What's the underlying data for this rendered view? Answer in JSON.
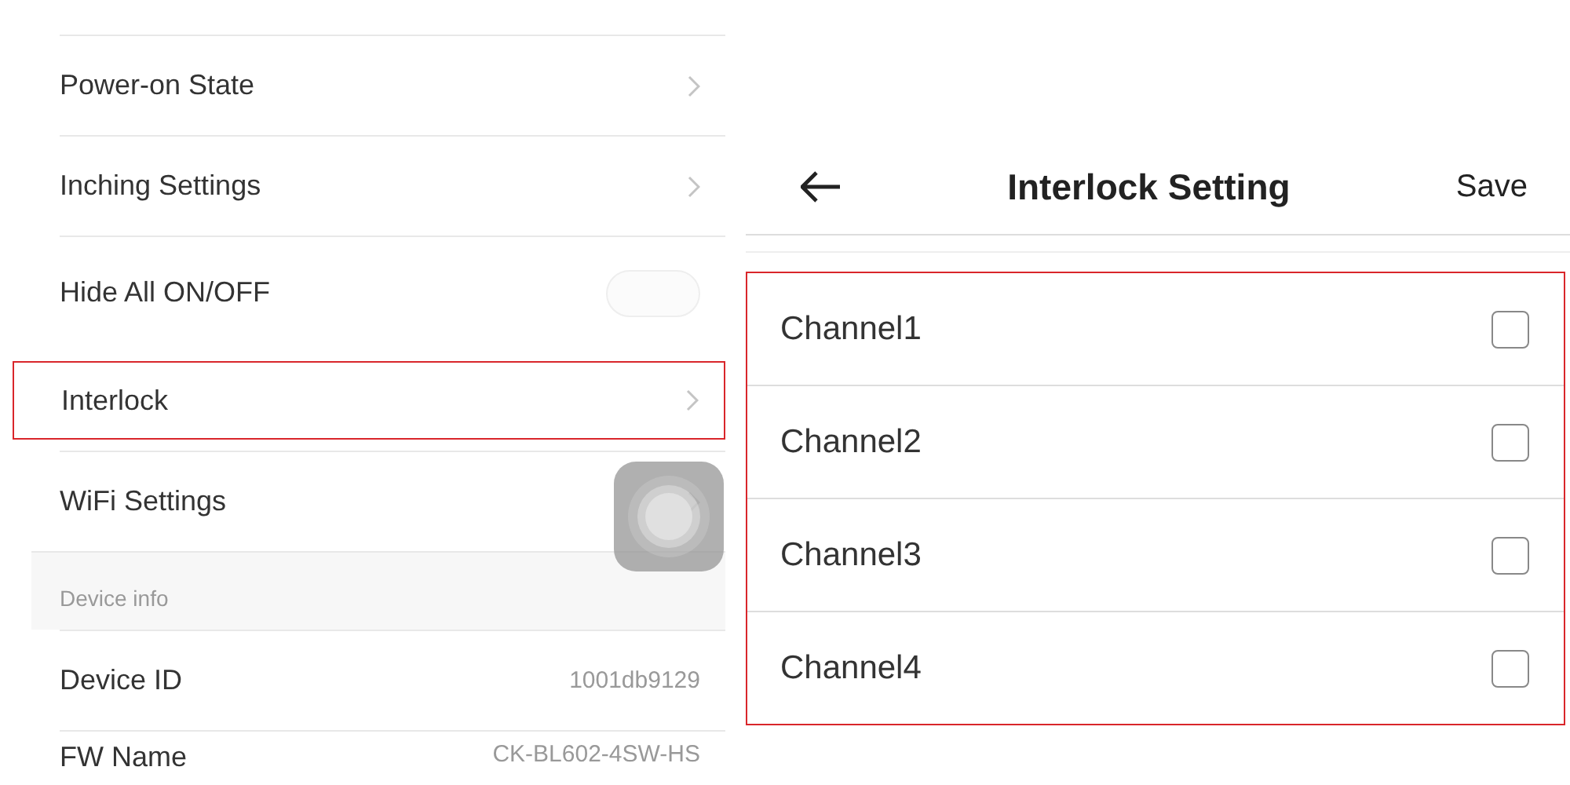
{
  "settings_list": {
    "items": [
      {
        "kind": "link",
        "label": "Power-on State",
        "highlighted": false
      },
      {
        "kind": "link",
        "label": "Inching Settings",
        "highlighted": false
      },
      {
        "kind": "toggle",
        "label": "Hide All ON/OFF",
        "on": false,
        "highlighted": false
      },
      {
        "kind": "link",
        "label": "Interlock",
        "highlighted": true
      },
      {
        "kind": "link",
        "label": "WiFi Settings",
        "highlighted": false
      },
      {
        "kind": "section",
        "label": "Device info",
        "highlighted": false
      },
      {
        "kind": "info",
        "label": "Device ID",
        "value": "1001db9129",
        "highlighted": false
      },
      {
        "kind": "info",
        "label": "FW Name",
        "value": "CK-BL602-4SW-HS",
        "highlighted": false
      }
    ]
  },
  "interlock_screen": {
    "title": "Interlock Setting",
    "save": "Save",
    "highlighted": true,
    "channels": [
      {
        "label": "Channel1",
        "checked": false
      },
      {
        "label": "Channel2",
        "checked": false
      },
      {
        "label": "Channel3",
        "checked": false
      },
      {
        "label": "Channel4",
        "checked": false
      }
    ]
  }
}
